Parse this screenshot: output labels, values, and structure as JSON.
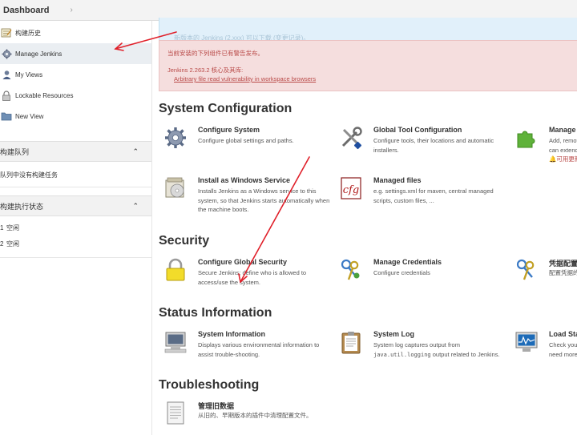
{
  "breadcrumb": {
    "root": "Dashboard",
    "separator": "›"
  },
  "sidebar": {
    "items": [
      {
        "label": "构建历史",
        "icon": "notepad-icon"
      },
      {
        "label": "Manage Jenkins",
        "icon": "gear-icon",
        "active": true
      },
      {
        "label": "My Views",
        "icon": "user-icon"
      },
      {
        "label": "Lockable Resources",
        "icon": "lock-icon"
      },
      {
        "label": "New View",
        "icon": "folder-icon"
      }
    ],
    "build_queue": {
      "title": "构建队列",
      "toggle": "⌃",
      "empty_text": "队列中没有构建任务"
    },
    "executors": {
      "title": "构建执行状态",
      "toggle": "⌃",
      "rows": [
        {
          "num": "1",
          "status": "空闲"
        },
        {
          "num": "2",
          "status": "空闲"
        }
      ]
    }
  },
  "notices": {
    "info_faint": "新版本的 Jenkins (2.xxx) 可以下载 (变更记录)。",
    "warning_title": "当前安装的下列组件已有警告发布。",
    "warning_sub": "Jenkins 2.263.2 核心及其库:",
    "warning_link": "Arbitrary file read vulnerability in workspace browsers"
  },
  "sections": {
    "system_configuration": "System Configuration",
    "security": "Security",
    "status_information": "Status Information",
    "troubleshooting": "Troubleshooting"
  },
  "items": {
    "configure_system": {
      "title": "Configure System",
      "desc": "Configure global settings and paths."
    },
    "global_tool_configuration": {
      "title": "Global Tool Configuration",
      "desc": "Configure tools, their locations and automatic installers."
    },
    "manage_plugins": {
      "title": "Manage P",
      "desc1": "Add, remov",
      "desc2": "can extend",
      "desc3": "可用更新"
    },
    "install_windows_service": {
      "title": "Install as Windows Service",
      "desc": "Installs Jenkins as a Windows service to this system, so that Jenkins starts automatically when the machine boots."
    },
    "managed_files": {
      "title": "Managed files",
      "desc": "e.g. settings.xml for maven, central managed scripts, custom files, ..."
    },
    "configure_global_security": {
      "title": "Configure Global Security",
      "desc": "Secure Jenkins; define who is allowed to access/use the system."
    },
    "manage_credentials": {
      "title": "Manage Credentials",
      "desc": "Configure credentials"
    },
    "credential_config": {
      "title": "凭据配置",
      "desc": "配置凭据的"
    },
    "system_information": {
      "title": "System Information",
      "desc": "Displays various environmental information to assist trouble-shooting."
    },
    "system_log": {
      "title": "System Log",
      "desc_pre": "System log captures output from ",
      "desc_code": "java.util.logging",
      "desc_post": " output related to Jenkins."
    },
    "load_statistics": {
      "title": "Load Stat",
      "desc1": "Check your",
      "desc2": "need more"
    },
    "manage_old_data": {
      "title": "管理旧数据",
      "desc": "从旧的、早期版本的插件中清理配置文件。"
    }
  },
  "colors": {
    "warning_bg": "#f5dede",
    "warning_text": "#b94a48",
    "info_bg": "#e1f0fa",
    "annotation_arrow": "#e0202a"
  }
}
